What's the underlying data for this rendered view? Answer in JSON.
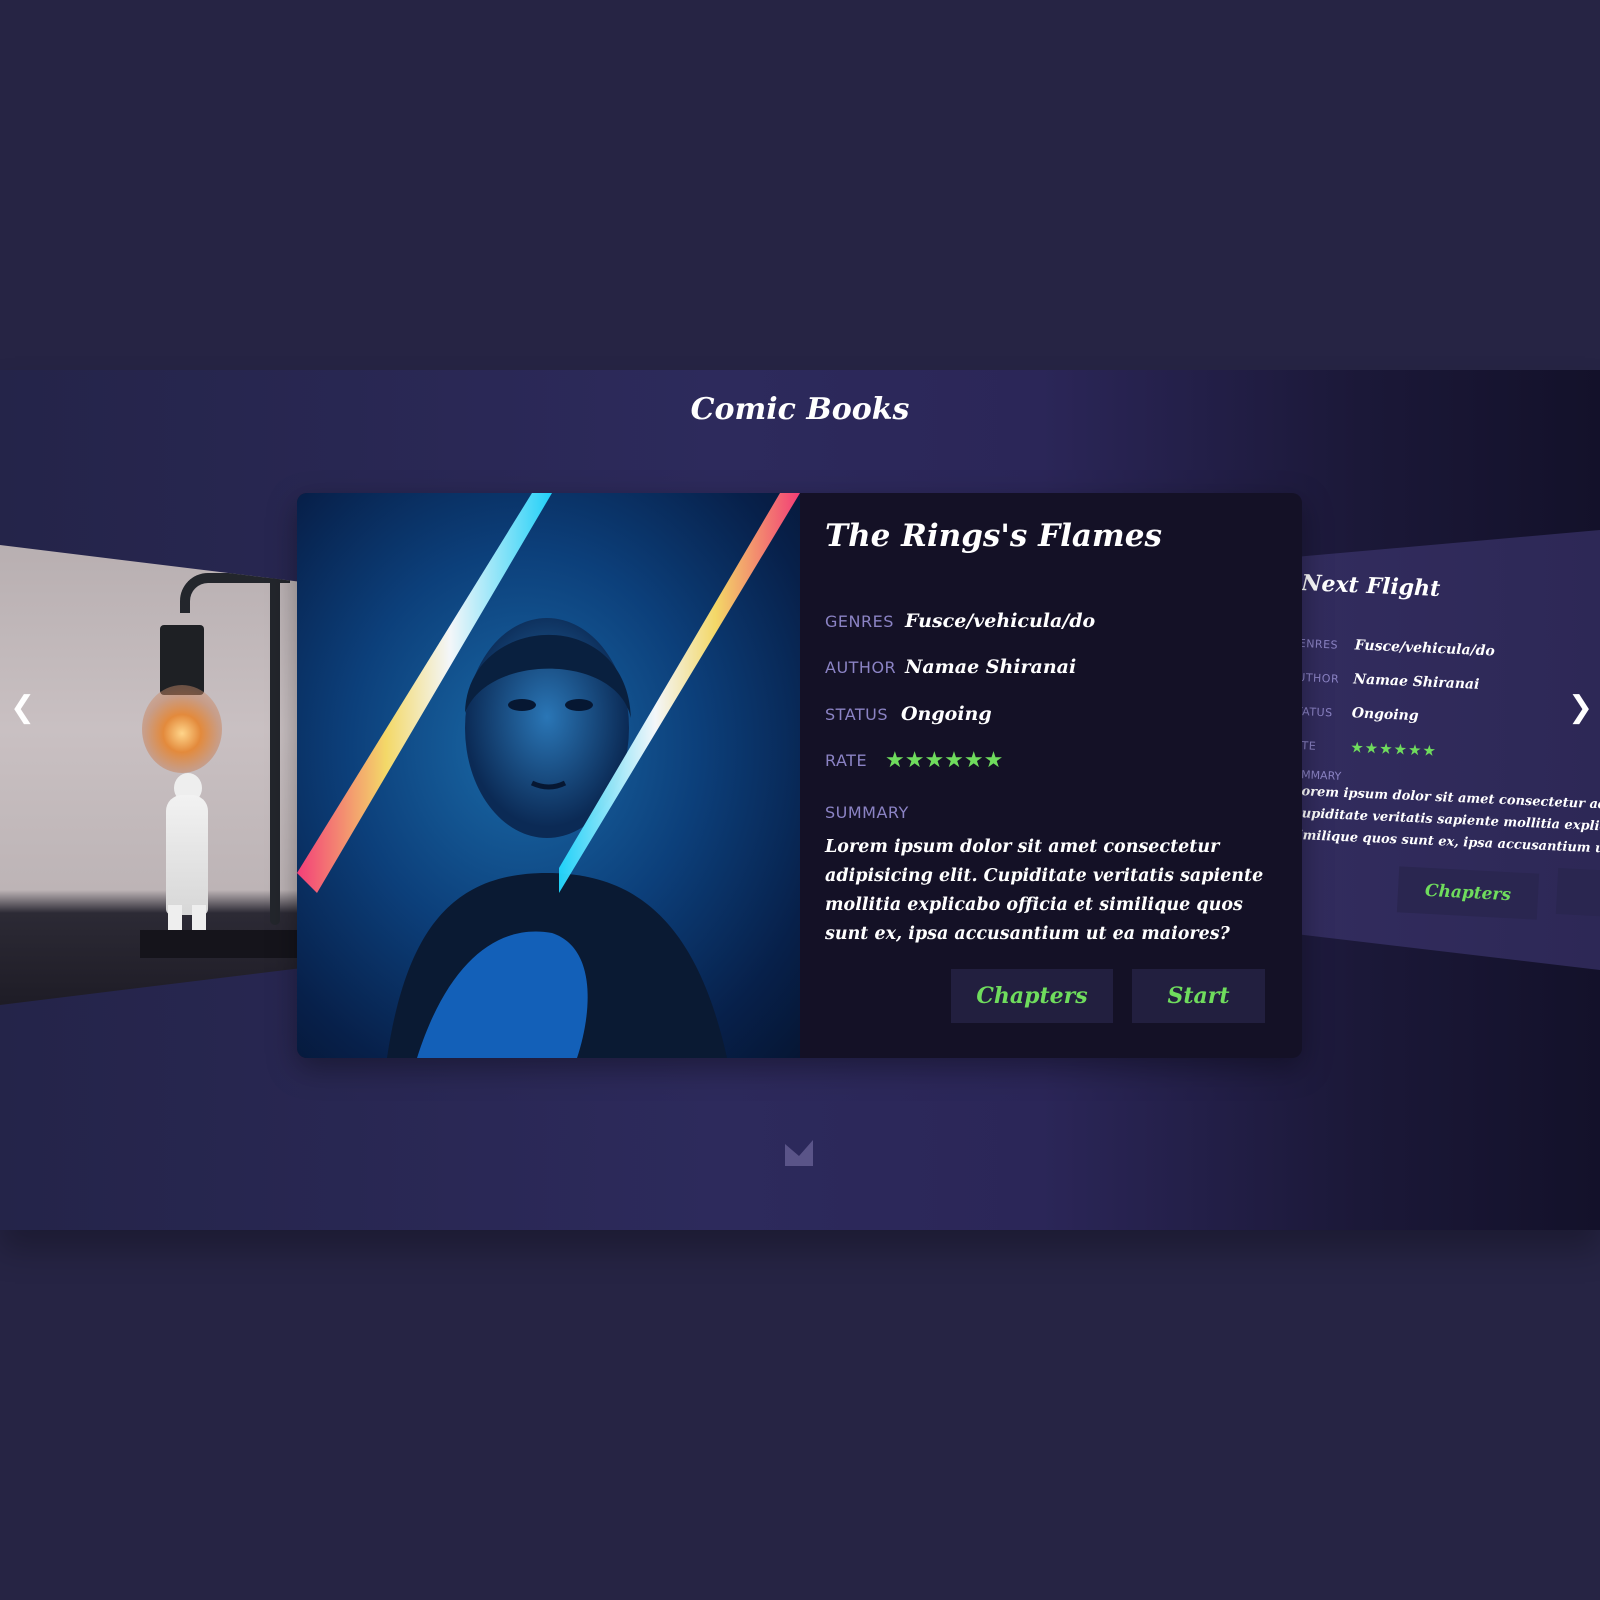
{
  "page": {
    "title": "Comic Books"
  },
  "nav": {
    "prev_glyph": "❮",
    "next_glyph": "❯"
  },
  "current_book": {
    "title": "The Rings's Flames",
    "fields": {
      "genres_label": "GENRES",
      "genres": "Fusce/vehicula/do",
      "author_label": "AUTHOR",
      "author": "Namae Shiranai",
      "status_label": "STATUS",
      "status": "Ongoing",
      "rate_label": "RATE",
      "rating": 6,
      "rating_stars": "★★★★★★"
    },
    "summary_label": "SUMMARY",
    "summary": "Lorem ipsum dolor sit amet consectetur adipisicing elit. Cupiditate veritatis sapiente mollitia explicabo officia et similique quos sunt ex, ipsa accusantium ut ea maiores?",
    "buttons": {
      "chapters": "Chapters",
      "start": "Start"
    }
  },
  "next_book": {
    "title": "Next Flight",
    "genres_label": "ENRES",
    "genres": "Fusce/vehicula/do",
    "author_label": "UTHOR",
    "author": "Namae Shiranai",
    "status_label": "TATUS",
    "status": "Ongoing",
    "rate_label": "ATE",
    "rating_stars": "★★★★★★",
    "summary_label": "UMMARY",
    "summary_lines": [
      "Lorem ipsum dolor sit amet consectetur adipi",
      "Cupiditate veritatis sapiente mollitia explicab",
      "similique quos sunt ex, ipsa accusantium ut ea"
    ],
    "chapters_label": "Chapters"
  },
  "colors": {
    "accent": "#6fdc5d",
    "label": "#8b83c4",
    "background": "#262444",
    "card": "#141126"
  }
}
